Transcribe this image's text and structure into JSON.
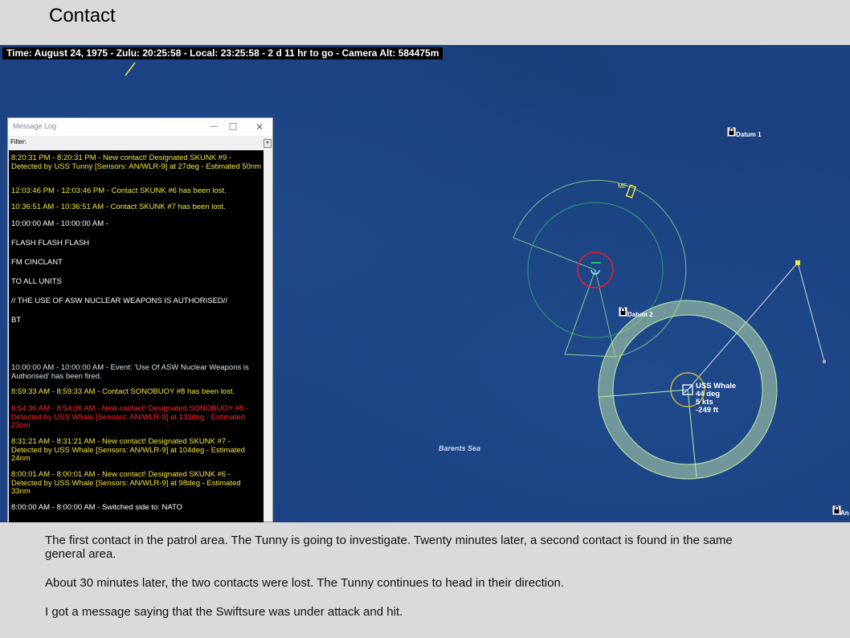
{
  "slide": {
    "title": "Contact",
    "captions": [
      "The first contact in the patrol area.  The Tunny is going to investigate.  Twenty minutes later, a second contact is found in the same general area.",
      "About 30 minutes later, the two contacts were lost.  The Tunny continues to head in their direction.",
      "I got a message saying that the Swiftsure was under attack and hit."
    ]
  },
  "map": {
    "status_bar": "Time: August 24, 1975 - Zulu: 20:25:58 - Local: 23:25:58 - 2 d 11 hr to go -  Camera Alt: 584475m",
    "datum1_label": "Datum 1",
    "datum2_label": "Datum 2",
    "mf_label": "MF",
    "corner_label": "An",
    "sea_label": "Barents Sea",
    "unit": {
      "name": "USS Whale",
      "heading": "44 deg",
      "speed": "5 kts",
      "depth": "-249 ft"
    },
    "icons": [
      "lock-icon",
      "submarine-icon",
      "sonobuoy-icon"
    ]
  },
  "message_log": {
    "title": "Message Log",
    "filter_label": "Filter:",
    "minimize_glyph": "—",
    "maximize_glyph": "☐",
    "close_glyph": "✕",
    "messages": [
      {
        "text": "8:20:31 PM - 8:20:31 PM - New contact! Designated SKUNK #9 - Detected by USS Tunny [Sensors: AN/WLR-9] at 27deg - Estimated 50nm",
        "color": "yellow"
      },
      {
        "text": "12:03:46 PM - 12:03:46 PM - Contact SKUNK #6 has been lost.",
        "color": "yellow"
      },
      {
        "text": "10:36:51 AM - 10:36:51 AM - Contact SKUNK #7 has been lost.",
        "color": "yellow"
      },
      {
        "text": "10:00:00 AM - 10:00:00 AM -",
        "color": "white"
      },
      {
        "text": "FLASH FLASH FLASH",
        "color": "white"
      },
      {
        "text": "FM CINCLANT",
        "color": "white"
      },
      {
        "text": "TO ALL UNITS",
        "color": "white"
      },
      {
        "text": "// THE USE OF ASW NUCLEAR WEAPONS IS AUTHORISED//",
        "color": "white"
      },
      {
        "text": "BT",
        "color": "white"
      },
      {
        "text": "10:00:00 AM - 10:00:00 AM - Event: 'Use Of ASW Nuclear Weapons is Authorised' has been fired.",
        "color": "cyan"
      },
      {
        "text": "8:59:33 AM - 8:59:33 AM - Contact SONOBUOY #8 has been lost.",
        "color": "yellow"
      },
      {
        "text": "8:54:36 AM - 8:54:36 AM - New contact! Designated SONOBUOY #8 - Detected by USS Whale [Sensors: AN/WLR-9] at 133deg - Estimated 23nm",
        "color": "red"
      },
      {
        "text": "8:31:21 AM - 8:31:21 AM - New contact! Designated SKUNK #7 - Detected by USS Whale [Sensors: AN/WLR-9] at 104deg - Estimated 24nm",
        "color": "yellow"
      },
      {
        "text": "8:00:01 AM - 8:00:01 AM - New contact! Designated SKUNK #6 - Detected by USS Whale [Sensors: AN/WLR-9] at 98deg - Estimated 33nm",
        "color": "yellow"
      },
      {
        "text": "8:00:00 AM - 8:00:00 AM - Switched side to: NATO",
        "color": "white"
      }
    ]
  }
}
